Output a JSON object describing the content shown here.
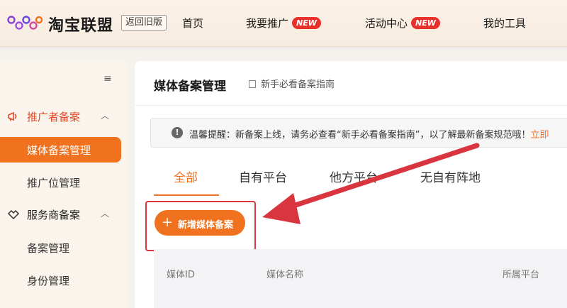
{
  "header": {
    "brand": "淘宝联盟",
    "old_version_label": "返回旧版",
    "nav": [
      {
        "label": "首页",
        "badge": ""
      },
      {
        "label": "我要推广",
        "badge": "NEW"
      },
      {
        "label": "活动中心",
        "badge": "NEW"
      },
      {
        "label": "我的工具",
        "badge": ""
      }
    ]
  },
  "sidebar": {
    "toggle_icon": "≡",
    "groups": [
      {
        "label": "推广者备案",
        "icon": "megaphone-icon",
        "items": [
          "媒体备案管理",
          "推广位管理"
        ]
      },
      {
        "label": "服务商备案",
        "icon": "handshake-icon",
        "items": [
          "备案管理",
          "身份管理"
        ]
      }
    ],
    "active_item": "媒体备案管理"
  },
  "main": {
    "title": "媒体备案管理",
    "guide_link": "新手必看备案指南",
    "notice": {
      "text": "温馨提醒：新备案上线，请务必查看“新手必看备案指南”，以了解最新备案规范哦！",
      "link": "立即"
    },
    "tabs": [
      "全部",
      "自有平台",
      "他方平台",
      "无自有阵地"
    ],
    "active_tab": "全部",
    "add_button": "新增媒体备案",
    "table_headers": [
      "媒体ID",
      "媒体名称",
      "所属平台"
    ]
  },
  "colors": {
    "accent": "#f0721f",
    "highlight": "#d8353f",
    "badge": "#e8312a"
  }
}
